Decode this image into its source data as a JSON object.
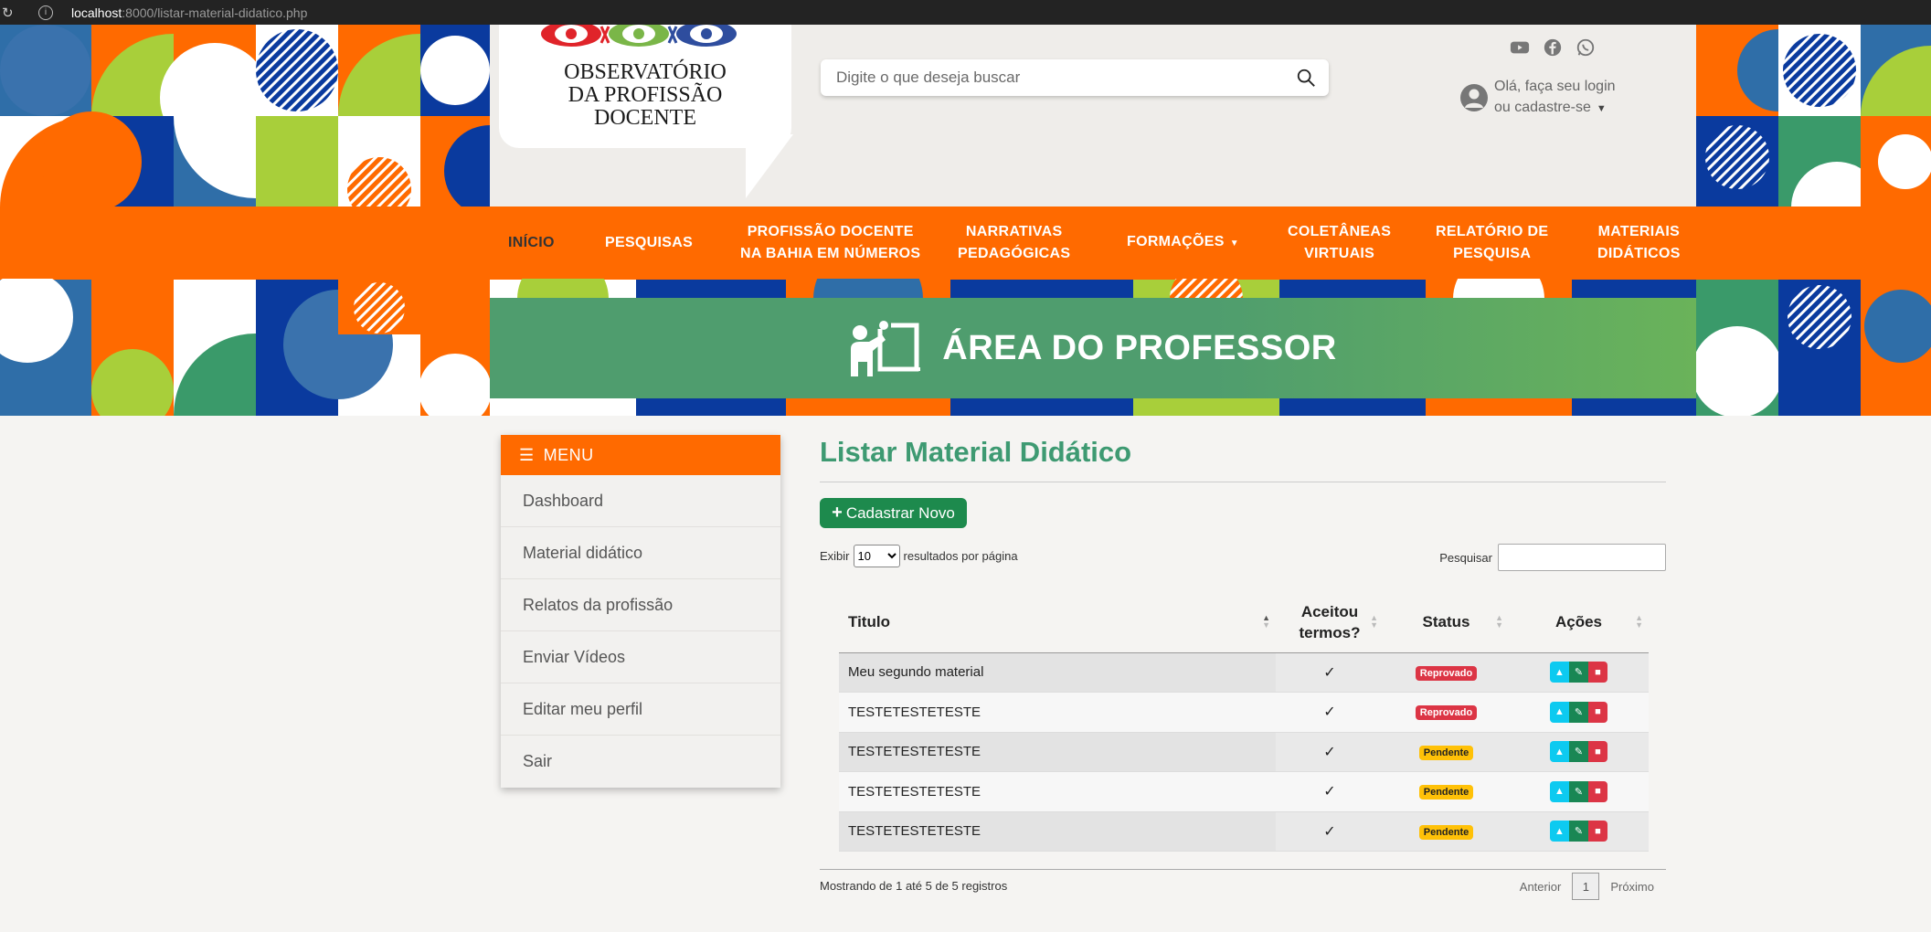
{
  "browser": {
    "host": "localhost",
    "path": ":8000/listar-material-didatico.php"
  },
  "logo": {
    "line1": "OBSERVATÓRIO",
    "line2": "DA PROFISSÃO",
    "line3": "DOCENTE"
  },
  "search": {
    "placeholder": "Digite o que deseja buscar"
  },
  "social": [
    "youtube-icon",
    "facebook-icon",
    "whatsapp-icon"
  ],
  "login": {
    "line1": "Olá, faça seu login",
    "line2": "ou cadastre-se"
  },
  "nav": [
    {
      "l1": "INÍCIO",
      "l2": ""
    },
    {
      "l1": "PESQUISAS",
      "l2": ""
    },
    {
      "l1": "PROFISSÃO DOCENTE",
      "l2": "NA BAHIA EM NÚMEROS"
    },
    {
      "l1": "NARRATIVAS",
      "l2": "PEDAGÓGICAS"
    },
    {
      "l1": "FORMAÇÕES",
      "l2": ""
    },
    {
      "l1": "COLETÂNEAS",
      "l2": "VIRTUAIS"
    },
    {
      "l1": "RELATÓRIO DE",
      "l2": "PESQUISA"
    },
    {
      "l1": "MATERIAIS",
      "l2": "DIDÁTICOS"
    }
  ],
  "area_title": "ÁREA DO PROFESSOR",
  "sidebar": {
    "heading": "MENU",
    "items": [
      "Dashboard",
      "Material didático",
      "Relatos da profissão",
      "Enviar Vídeos",
      "Editar meu perfil",
      "Sair"
    ]
  },
  "page_title": "Listar Material Didático",
  "new_button": "Cadastrar Novo",
  "length": {
    "before": "Exibir",
    "value": "10",
    "after": "resultados por página"
  },
  "filter_label": "Pesquisar",
  "table": {
    "headers": [
      "Titulo",
      "Aceitou termos?",
      "Status",
      "Ações"
    ],
    "rows": [
      {
        "title": "Meu segundo material",
        "accepted": "✓",
        "status": "Reprovado",
        "status_color": "#dc3545"
      },
      {
        "title": "TESTETESTETESTE",
        "accepted": "✓",
        "status": "Reprovado",
        "status_color": "#dc3545"
      },
      {
        "title": "TESTETESTETESTE",
        "accepted": "✓",
        "status": "Pendente",
        "status_color": "#ffc107"
      },
      {
        "title": "TESTETESTETESTE",
        "accepted": "✓",
        "status": "Pendente",
        "status_color": "#ffc107"
      },
      {
        "title": "TESTETESTETESTE",
        "accepted": "✓",
        "status": "Pendente",
        "status_color": "#ffc107"
      }
    ]
  },
  "info": "Mostrando de 1 até 5 de 5 registros",
  "pager": {
    "prev": "Anterior",
    "current": "1",
    "next": "Próximo"
  },
  "colors": {
    "orange": "#ff6a00",
    "green_title": "#3e9a72",
    "green_button": "#1d8a4d"
  }
}
